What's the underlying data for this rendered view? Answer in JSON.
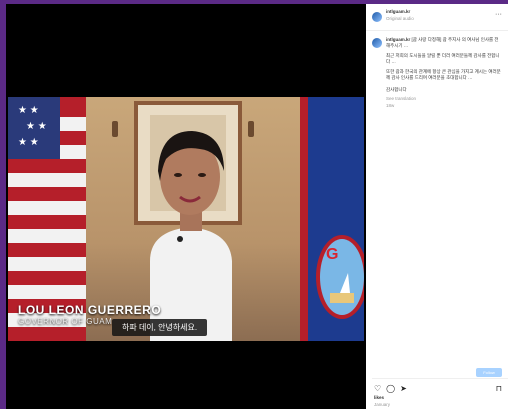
{
  "post": {
    "account": "intlguam.kr",
    "location": "Original audio",
    "caption_account": "intlguam.kr",
    "caption_line1": "[괌 사랑 다정해]",
    "caption_mid": "괌 주지사 의 여사님 인사를 전해주시기 …",
    "caption_p2": "최근 저희의 도시들을 알릴 뿐 더러 여러분들께 감사를 전합니다 …",
    "caption_p3": "또한 괌과 한국의 관계에 항상 큰 관심을 가지고 계시는 여러분께 감사 인사를 드리며 여러분을 초대합니다 …",
    "caption_thanks": "감사합니다",
    "translate": "See translation",
    "time": "18w",
    "follow_label": "Follow",
    "likes": "likes",
    "date": "January"
  },
  "video": {
    "name_overlay": "LOU LEON GUERRERO",
    "title_overlay": "GOVERNOR OF GUAM",
    "subtitle": "하파 데이, 안녕하세요."
  },
  "icons": {
    "heart": "heart-icon",
    "comment": "comment-icon",
    "share": "share-icon",
    "bookmark": "bookmark-icon",
    "more": "more-icon"
  },
  "colors": {
    "background": "#5b2a86",
    "follow_button": "#a8d2ff"
  }
}
